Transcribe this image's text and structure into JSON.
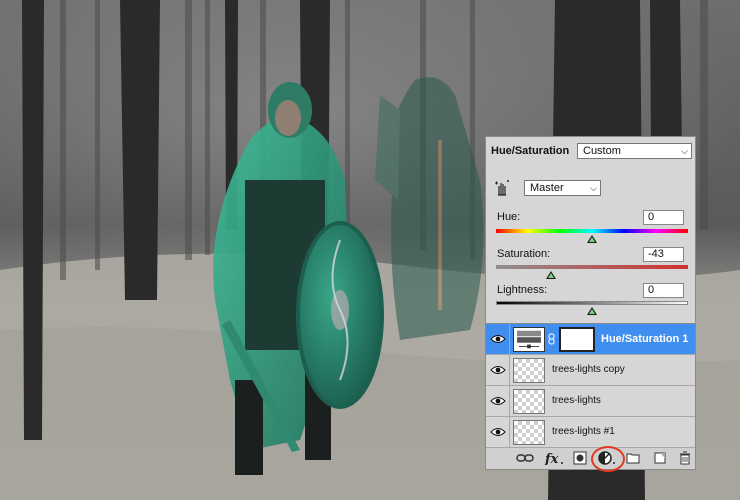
{
  "adjustments": {
    "title": "Hue/Saturation",
    "preset": "Custom",
    "channel": "Master",
    "hue": {
      "label": "Hue:",
      "value": "0",
      "level": 0.5
    },
    "saturation": {
      "label": "Saturation:",
      "value": "-43",
      "level": 0.285
    },
    "lightness": {
      "label": "Lightness:",
      "value": "0",
      "level": 0.5
    }
  },
  "layers": [
    {
      "name": "Hue/Saturation 1",
      "selected": true,
      "type": "adjustment"
    },
    {
      "name": "trees-lights copy",
      "selected": false,
      "type": "pixel"
    },
    {
      "name": "trees-lights",
      "selected": false,
      "type": "pixel"
    },
    {
      "name": "trees-lights #1",
      "selected": false,
      "type": "pixel"
    }
  ],
  "footer_icons": [
    "link-icon",
    "fx-icon",
    "add-mask-icon",
    "new-adjustment-layer-icon",
    "new-group-icon",
    "new-layer-icon",
    "trash-icon"
  ],
  "colors": {
    "selection": "#3f8ef0",
    "highlight": "#e23a1e",
    "thumb_fill": "#7ed07e"
  }
}
